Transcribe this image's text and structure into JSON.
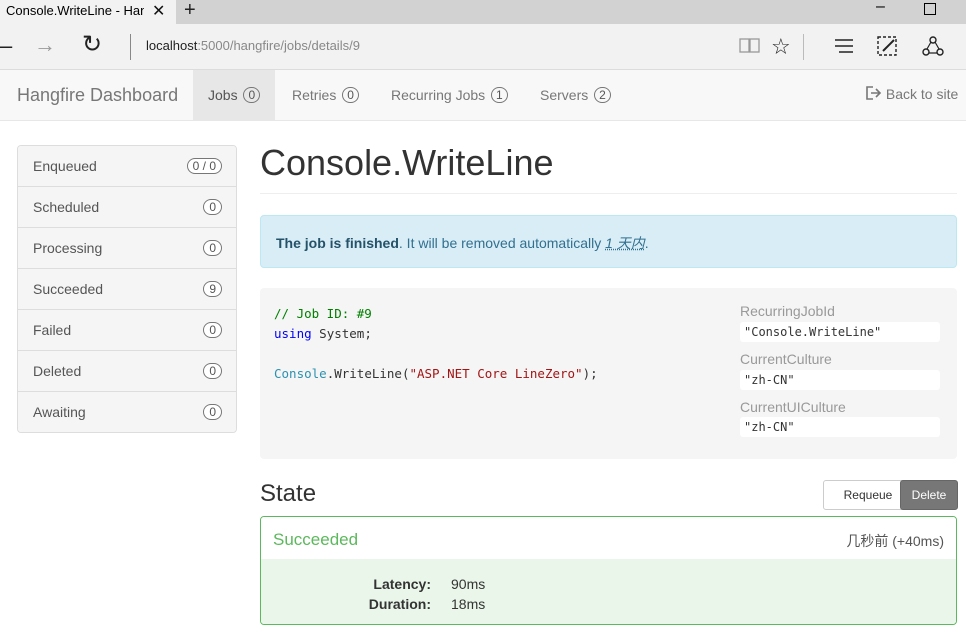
{
  "browser": {
    "tab_title": "Console.WriteLine - Han",
    "url_host": "localhost",
    "url_path": ":5000/hangfire/jobs/details/9"
  },
  "navbar": {
    "brand": "Hangfire Dashboard",
    "tabs": [
      {
        "label": "Jobs",
        "count": "0"
      },
      {
        "label": "Retries",
        "count": "0"
      },
      {
        "label": "Recurring Jobs",
        "count": "1"
      },
      {
        "label": "Servers",
        "count": "2"
      }
    ],
    "back_link": "Back to site"
  },
  "sidebar": {
    "items": [
      {
        "label": "Enqueued",
        "count": "0 / 0"
      },
      {
        "label": "Scheduled",
        "count": "0"
      },
      {
        "label": "Processing",
        "count": "0"
      },
      {
        "label": "Succeeded",
        "count": "9"
      },
      {
        "label": "Failed",
        "count": "0"
      },
      {
        "label": "Deleted",
        "count": "0"
      },
      {
        "label": "Awaiting",
        "count": "0"
      }
    ]
  },
  "job": {
    "title": "Console.WriteLine",
    "alert_strong": "The job is finished",
    "alert_text": ". It will be removed automatically ",
    "alert_time": "1 天内",
    "alert_end": ".",
    "code": {
      "comment": "// Job ID: #9",
      "using_kw": "using",
      "using_ns": " System;",
      "type": "Console",
      "method": ".WriteLine(",
      "string": "\"ASP.NET Core LineZero\"",
      "end": ");"
    },
    "parameters": [
      {
        "name": "RecurringJobId",
        "value": "\"Console.WriteLine\""
      },
      {
        "name": "CurrentCulture",
        "value": "\"zh-CN\""
      },
      {
        "name": "CurrentUICulture",
        "value": "\"zh-CN\""
      }
    ]
  },
  "state": {
    "heading": "State",
    "requeue_label": "Requeue",
    "delete_label": "Delete",
    "name": "Succeeded",
    "time": "几秒前 (+40ms)",
    "details": [
      {
        "key": "Latency:",
        "value": "90ms"
      },
      {
        "key": "Duration:",
        "value": "18ms"
      }
    ]
  }
}
